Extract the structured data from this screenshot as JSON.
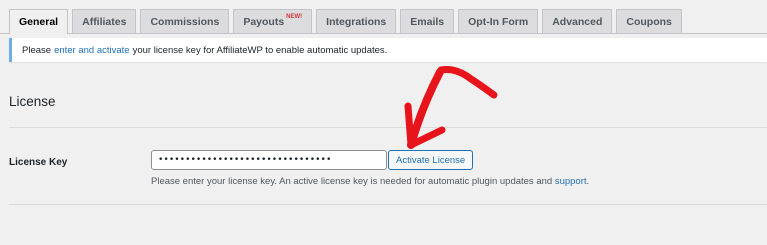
{
  "tabs": [
    {
      "label": "General",
      "active": true
    },
    {
      "label": "Affiliates"
    },
    {
      "label": "Commissions"
    },
    {
      "label": "Payouts",
      "badge": "NEW!"
    },
    {
      "label": "Integrations"
    },
    {
      "label": "Emails"
    },
    {
      "label": "Opt-In Form"
    },
    {
      "label": "Advanced"
    },
    {
      "label": "Coupons"
    }
  ],
  "notice": {
    "prefix": "Please",
    "link": "enter and activate",
    "suffix": "your license key for AffiliateWP to enable automatic updates."
  },
  "section": {
    "title": "License"
  },
  "license": {
    "label": "License Key",
    "value": "••••••••••••••••••••••••••••••••",
    "button": "Activate License",
    "help_text": "Please enter your license key. An active license key is needed for automatic plugin updates and",
    "help_link": "support",
    "help_end": "."
  },
  "colors": {
    "accent": "#2271b1",
    "notice_border": "#72aee6",
    "annotation_arrow": "#e8141c"
  }
}
